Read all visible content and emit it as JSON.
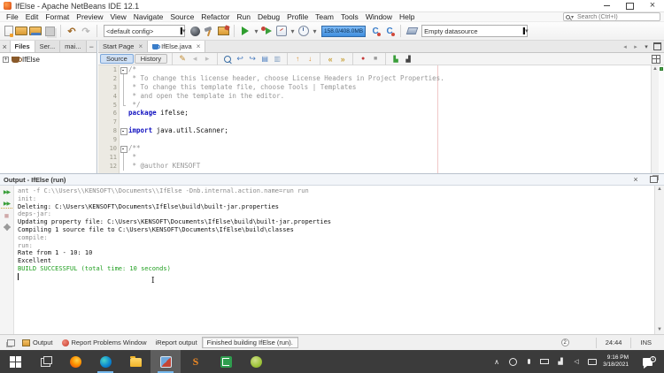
{
  "window": {
    "title": "IfElse - Apache NetBeans IDE 12.1",
    "controls": [
      "minimize",
      "maximize",
      "close"
    ]
  },
  "menubar": {
    "items": [
      "File",
      "Edit",
      "Format",
      "Preview",
      "View",
      "Navigate",
      "Source",
      "Refactor",
      "Run",
      "Debug",
      "Profile",
      "Team",
      "Tools",
      "Window",
      "Help"
    ]
  },
  "search": {
    "placeholder": "Search (Ctrl+I)"
  },
  "toolbar": {
    "left_icons": [
      "new-file",
      "new-project",
      "open-project",
      "save-all",
      "sep",
      "undo",
      "redo",
      "sep"
    ],
    "config_value": "<default config>",
    "mid_icons": [
      "deploy",
      "build",
      "clean-build",
      "sep",
      "run",
      "dropdown",
      "debug",
      "profile",
      "dropdown",
      "history-clock",
      "dropdown"
    ],
    "memory": "158.0/408.0MB",
    "right_icons": [
      "gc-1",
      "gc-2",
      "sep",
      "eraser"
    ],
    "datasource_value": "Empty datasource"
  },
  "explorer": {
    "tabs": [
      {
        "label": "Files",
        "active": true
      },
      {
        "label": "Ser...",
        "active": false
      },
      {
        "label": "mai...",
        "active": false
      }
    ],
    "items": [
      {
        "label": "IfElse"
      }
    ]
  },
  "editor": {
    "tabs": [
      {
        "label": "Start Page",
        "active": false,
        "icon": ""
      },
      {
        "label": "IfElse.java",
        "active": true,
        "icon": "java"
      }
    ],
    "views": [
      {
        "label": "Source",
        "active": true
      },
      {
        "label": "History",
        "active": false
      }
    ],
    "toolbar_icons": [
      "last-edited",
      "prev-edit",
      "next-edit",
      "sep",
      "find",
      "back-arrow",
      "forward-arrow",
      "copy-history",
      "selection",
      "sep",
      "prev-occurrence",
      "next-occurrence",
      "sep",
      "prev-bookmark",
      "next-bookmark",
      "sep",
      "record-macro",
      "stop-macro",
      "sep",
      "comment",
      "uncomment"
    ],
    "lines": [
      {
        "n": "1",
        "fold": "start",
        "segs": [
          {
            "t": "/*",
            "c": "comment"
          }
        ]
      },
      {
        "n": "2",
        "fold": "mid",
        "segs": [
          {
            "t": " * To change this license header, choose License Headers in Project Properties.",
            "c": "comment"
          }
        ]
      },
      {
        "n": "3",
        "fold": "mid",
        "segs": [
          {
            "t": " * To change this template file, choose Tools | Templates",
            "c": "comment"
          }
        ]
      },
      {
        "n": "4",
        "fold": "mid",
        "segs": [
          {
            "t": " * and open the template in the editor.",
            "c": "comment"
          }
        ]
      },
      {
        "n": "5",
        "fold": "end",
        "segs": [
          {
            "t": " */",
            "c": "comment"
          }
        ]
      },
      {
        "n": "6",
        "fold": "",
        "segs": [
          {
            "t": "package",
            "c": "keyword"
          },
          {
            "t": " ifelse;",
            "c": "plain"
          }
        ]
      },
      {
        "n": "7",
        "fold": "",
        "segs": []
      },
      {
        "n": "8",
        "fold": "start",
        "segs": [
          {
            "t": "import",
            "c": "keyword"
          },
          {
            "t": " java.util.Scanner;",
            "c": "plain"
          }
        ]
      },
      {
        "n": "9",
        "fold": "",
        "segs": []
      },
      {
        "n": "10",
        "fold": "start",
        "segs": [
          {
            "t": "/**",
            "c": "comment"
          }
        ]
      },
      {
        "n": "11",
        "fold": "mid",
        "segs": [
          {
            "t": " *",
            "c": "comment"
          }
        ]
      },
      {
        "n": "12",
        "fold": "mid",
        "segs": [
          {
            "t": " * @author KENSOFT",
            "c": "comment"
          }
        ]
      }
    ]
  },
  "output": {
    "title": "Output - IfElse (run)",
    "left_icons": [
      "rerun",
      "rerun-params",
      "stop",
      "ant-settings"
    ],
    "lines": [
      {
        "text": "ant -f C:\\\\Users\\\\KENSOFT\\\\Documents\\\\IfElse -Dnb.internal.action.name=run run",
        "style": "muted"
      },
      {
        "text": "init:",
        "style": "muted"
      },
      {
        "text": "Deleting: C:\\Users\\KENSOFT\\Documents\\IfElse\\build\\built-jar.properties",
        "style": "plain"
      },
      {
        "text": "deps-jar:",
        "style": "muted"
      },
      {
        "text": "Updating property file: C:\\Users\\KENSOFT\\Documents\\IfElse\\build\\built-jar.properties",
        "style": "plain"
      },
      {
        "text": "Compiling 1 source file to C:\\Users\\KENSOFT\\Documents\\IfElse\\build\\classes",
        "style": "plain"
      },
      {
        "text": "compile:",
        "style": "muted"
      },
      {
        "text": "run:",
        "style": "muted"
      },
      {
        "text": "Rate from 1 - 10: 10",
        "style": "plain"
      },
      {
        "text": "Excellent",
        "style": "plain"
      },
      {
        "text": "BUILD SUCCESSFUL (total time: 10 seconds)",
        "style": "success"
      }
    ]
  },
  "statusbar": {
    "buttons": [
      {
        "label": "Output",
        "icon": "output-window"
      },
      {
        "label": "Report Problems Window",
        "icon": "report-problems"
      },
      {
        "label": "iReport output",
        "icon": "none"
      }
    ],
    "message": "Finished building IfElse (run).",
    "notification_count": "2",
    "caret_position": "24:44",
    "insert_mode": "INS"
  },
  "taskbar": {
    "apps": [
      {
        "name": "start",
        "active": false,
        "running": false
      },
      {
        "name": "task-view",
        "active": false,
        "running": false
      },
      {
        "name": "firefox",
        "active": false,
        "running": false
      },
      {
        "name": "edge",
        "active": false,
        "running": true
      },
      {
        "name": "file-explorer",
        "active": false,
        "running": false
      },
      {
        "name": "netbeans",
        "active": true,
        "running": true
      },
      {
        "name": "app-s",
        "active": false,
        "running": false
      },
      {
        "name": "app-e",
        "active": false,
        "running": false
      },
      {
        "name": "app-globe",
        "active": false,
        "running": false
      }
    ],
    "tray": [
      "tray-expand",
      "clock-tray",
      "mic",
      "battery",
      "network",
      "volume",
      "touch-keyboard"
    ],
    "time": "9:16 PM",
    "date": "3/18/2021",
    "notification_badge": "1"
  },
  "colors": {
    "accent": "#3f8ede",
    "success": "#1e9e1e",
    "keyword": "#1111c0",
    "comment": "#969696",
    "taskbar": "#3b3b3b"
  }
}
